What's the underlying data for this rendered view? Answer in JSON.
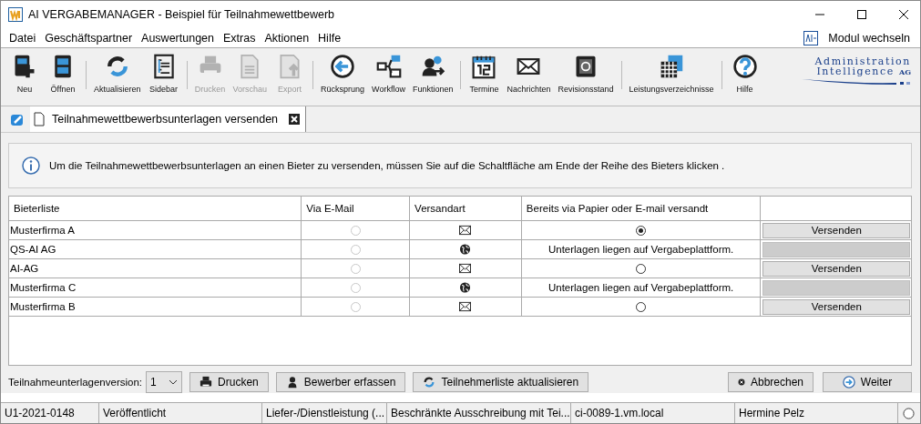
{
  "window": {
    "title": "AI VERGABEMANAGER - Beispiel für Teilnahmewettbewerb"
  },
  "menu": [
    "Datei",
    "Geschäftspartner",
    "Auswertungen",
    "Extras",
    "Aktionen",
    "Hilfe"
  ],
  "module_switch": "Modul wechseln",
  "toolbar": [
    {
      "label": "Neu",
      "disabled": false
    },
    {
      "label": "Öffnen",
      "disabled": false
    },
    {
      "label": "Aktualisieren",
      "disabled": false
    },
    {
      "label": "Sidebar",
      "disabled": false
    },
    {
      "label": "Drucken",
      "disabled": true
    },
    {
      "label": "Vorschau",
      "disabled": true
    },
    {
      "label": "Export",
      "disabled": true
    },
    {
      "label": "Rücksprung",
      "disabled": false
    },
    {
      "label": "Workflow",
      "disabled": false
    },
    {
      "label": "Funktionen",
      "disabled": false
    },
    {
      "label": "Termine",
      "disabled": false
    },
    {
      "label": "Nachrichten",
      "disabled": false
    },
    {
      "label": "Revisionsstand",
      "disabled": false
    },
    {
      "label": "Leistungsverzeichnisse",
      "disabled": false
    },
    {
      "label": "Hilfe",
      "disabled": false
    }
  ],
  "logo": {
    "line_1": "Administration",
    "line_2": "Intelligence",
    "suffix": "AG"
  },
  "tabs": [
    {
      "label": "Teilnahmewettbewerbsunterlagen versenden",
      "selected": true
    }
  ],
  "info": "Um die Teilnahmewettbewerbsunterlagen an einen Bieter zu versenden, müssen Sie auf die Schaltfläche am Ende der Reihe des Bieters klicken .",
  "table": {
    "columns": [
      "Bieterliste",
      "Via E-Mail",
      "Versandart",
      "Bereits via Papier oder E-mail versandt"
    ],
    "rows": [
      {
        "bidder": "Musterfirma A",
        "via_email": false,
        "delivery": {
          "kind": "mail"
        },
        "sent": {
          "kind": "radio",
          "checked": true
        },
        "action": {
          "label": "Versenden",
          "disabled": false
        }
      },
      {
        "bidder": "QS-AI AG",
        "via_email": false,
        "delivery": {
          "kind": "web"
        },
        "sent": {
          "kind": "text",
          "text": "Unterlagen liegen auf Vergabeplattform."
        },
        "action": {
          "disabled": true
        }
      },
      {
        "bidder": "AI-AG",
        "via_email": false,
        "delivery": {
          "kind": "mail"
        },
        "sent": {
          "kind": "radio",
          "checked": false
        },
        "action": {
          "label": "Versenden",
          "disabled": false
        }
      },
      {
        "bidder": "Musterfirma C",
        "via_email": false,
        "delivery": {
          "kind": "web"
        },
        "sent": {
          "kind": "text",
          "text": "Unterlagen liegen auf Vergabeplattform."
        },
        "action": {
          "disabled": true
        }
      },
      {
        "bidder": "Musterfirma B",
        "via_email": false,
        "delivery": {
          "kind": "mail"
        },
        "sent": {
          "kind": "radio",
          "checked": false
        },
        "action": {
          "label": "Versenden",
          "disabled": false
        }
      }
    ]
  },
  "version": {
    "label": "Teilnahmeunterlagenversion:",
    "value": "1"
  },
  "buttons_left": [
    "Drucken",
    "Bewerber erfassen",
    "Teilnehmerliste aktualisieren"
  ],
  "buttons_right": [
    "Abbrechen",
    "Weiter"
  ],
  "status_bar": [
    "U1-2021-0148",
    "Veröffentlicht",
    "Liefer-/Dienstleistung (...",
    "Beschränkte Ausschreibung mit Tei...",
    "ci-0089-1.vm.local",
    "Hermine Pelz"
  ]
}
